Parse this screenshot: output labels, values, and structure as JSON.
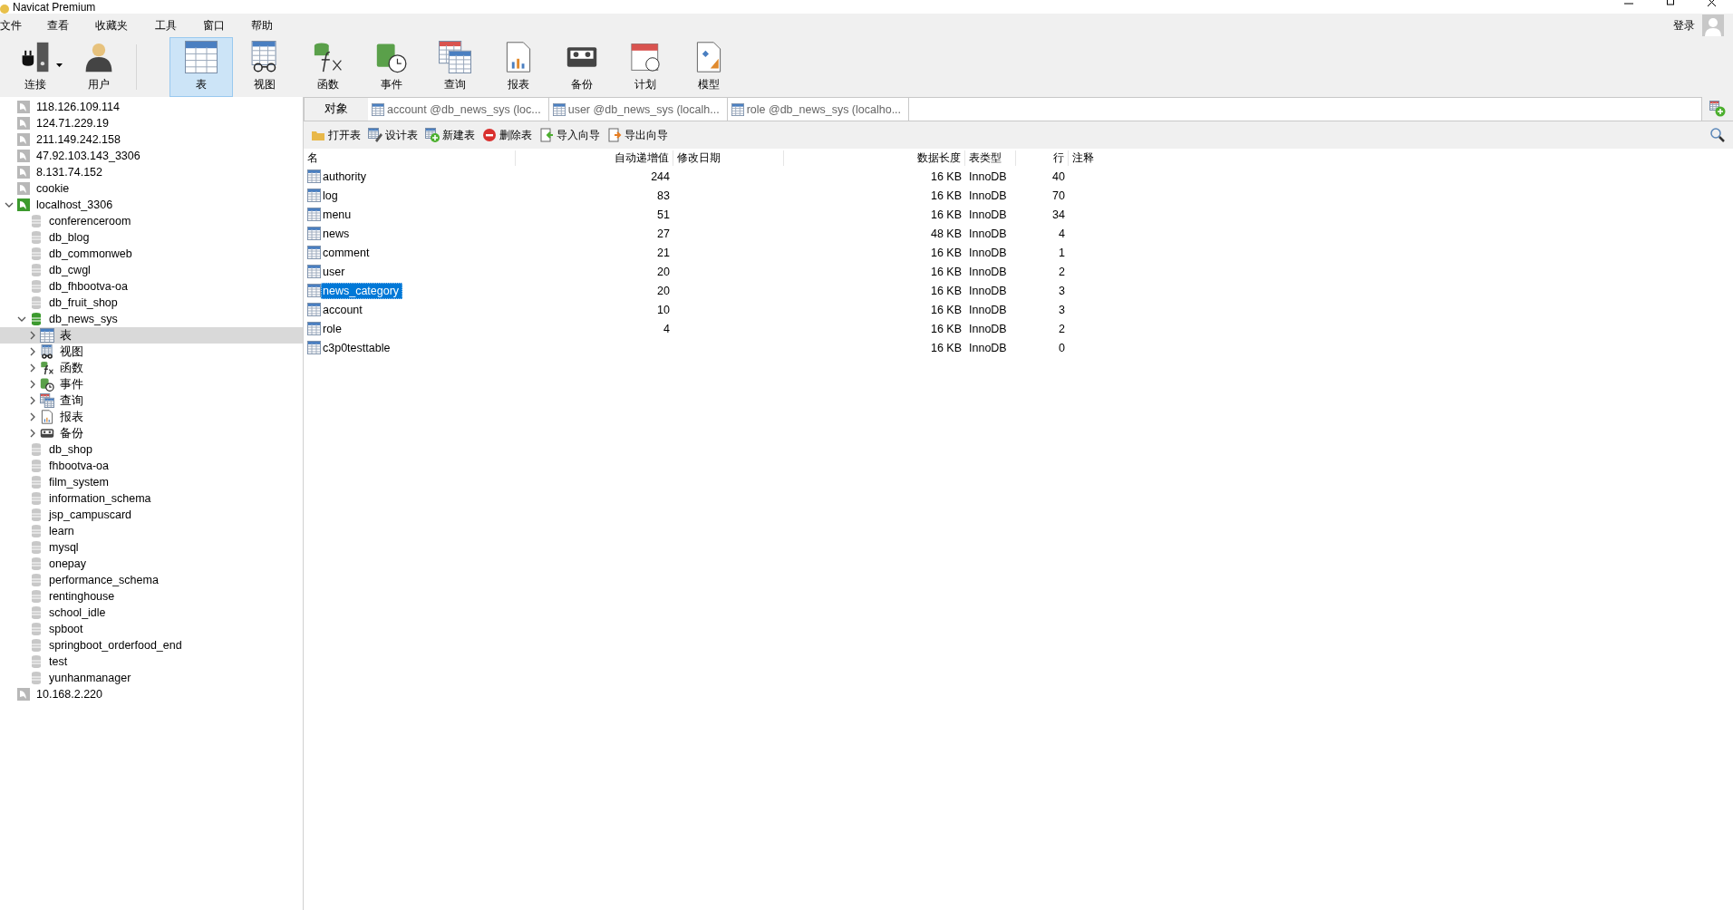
{
  "window": {
    "title": "Navicat Premium"
  },
  "menu": [
    "文件",
    "查看",
    "收藏夹",
    "工具",
    "窗口",
    "帮助"
  ],
  "account": {
    "label": "登录"
  },
  "toolbar": {
    "left": [
      {
        "kind": "connection",
        "label": "连接",
        "has_menu": true,
        "selected": false
      },
      {
        "kind": "user",
        "label": "用户",
        "has_menu": false,
        "selected": false
      }
    ],
    "objects": [
      {
        "kind": "table",
        "label": "表",
        "selected": true
      },
      {
        "kind": "view",
        "label": "视图",
        "selected": false
      },
      {
        "kind": "function",
        "label": "函数",
        "selected": false
      },
      {
        "kind": "event",
        "label": "事件",
        "selected": false
      },
      {
        "kind": "query",
        "label": "查询",
        "selected": false
      },
      {
        "kind": "report",
        "label": "报表",
        "selected": false
      },
      {
        "kind": "backup",
        "label": "备份",
        "selected": false
      },
      {
        "kind": "schedule",
        "label": "计划",
        "selected": false
      },
      {
        "kind": "model",
        "label": "模型",
        "selected": false
      }
    ]
  },
  "tree": [
    {
      "kind": "connection",
      "label": "118.126.109.114",
      "open": false,
      "selected": false
    },
    {
      "kind": "connection",
      "label": "124.71.229.19",
      "open": false,
      "selected": false
    },
    {
      "kind": "connection",
      "label": "211.149.242.158",
      "open": false,
      "selected": false
    },
    {
      "kind": "connection",
      "label": "47.92.103.143_3306",
      "open": false,
      "selected": false
    },
    {
      "kind": "connection",
      "label": "8.131.74.152",
      "open": false,
      "selected": false
    },
    {
      "kind": "connection",
      "label": "cookie",
      "open": false,
      "selected": false
    },
    {
      "kind": "connection",
      "label": "localhost_3306",
      "open": true,
      "expanded": true,
      "selected": false,
      "children": [
        {
          "kind": "database",
          "label": "conferenceroom",
          "open": false,
          "selected": false
        },
        {
          "kind": "database",
          "label": "db_blog",
          "open": false,
          "selected": false
        },
        {
          "kind": "database",
          "label": "db_commonweb",
          "open": false,
          "selected": false
        },
        {
          "kind": "database",
          "label": "db_cwgl",
          "open": false,
          "selected": false
        },
        {
          "kind": "database",
          "label": "db_fhbootva-oa",
          "open": false,
          "selected": false
        },
        {
          "kind": "database",
          "label": "db_fruit_shop",
          "open": false,
          "selected": false
        },
        {
          "kind": "database",
          "label": "db_news_sys",
          "open": true,
          "expanded": true,
          "selected": false,
          "children": [
            {
              "kind": "table",
              "label": "表",
              "expanded": false,
              "selected": true
            },
            {
              "kind": "view",
              "label": "视图",
              "expanded": false,
              "selected": false
            },
            {
              "kind": "function",
              "label": "函数",
              "expanded": false,
              "selected": false
            },
            {
              "kind": "event",
              "label": "事件",
              "expanded": false,
              "selected": false
            },
            {
              "kind": "query",
              "label": "查询",
              "expanded": false,
              "selected": false
            },
            {
              "kind": "report",
              "label": "报表",
              "expanded": false,
              "selected": false
            },
            {
              "kind": "backup",
              "label": "备份",
              "expanded": false,
              "selected": false
            }
          ]
        },
        {
          "kind": "database",
          "label": "db_shop",
          "open": false,
          "selected": false
        },
        {
          "kind": "database",
          "label": "fhbootva-oa",
          "open": false,
          "selected": false
        },
        {
          "kind": "database",
          "label": "film_system",
          "open": false,
          "selected": false
        },
        {
          "kind": "database",
          "label": "information_schema",
          "open": false,
          "selected": false
        },
        {
          "kind": "database",
          "label": "jsp_campuscard",
          "open": false,
          "selected": false
        },
        {
          "kind": "database",
          "label": "learn",
          "open": false,
          "selected": false
        },
        {
          "kind": "database",
          "label": "mysql",
          "open": false,
          "selected": false
        },
        {
          "kind": "database",
          "label": "onepay",
          "open": false,
          "selected": false
        },
        {
          "kind": "database",
          "label": "performance_schema",
          "open": false,
          "selected": false
        },
        {
          "kind": "database",
          "label": "rentinghouse",
          "open": false,
          "selected": false
        },
        {
          "kind": "database",
          "label": "school_idle",
          "open": false,
          "selected": false
        },
        {
          "kind": "database",
          "label": "spboot",
          "open": false,
          "selected": false
        },
        {
          "kind": "database",
          "label": "springboot_orderfood_end",
          "open": false,
          "selected": false
        },
        {
          "kind": "database",
          "label": "test",
          "open": false,
          "selected": false
        },
        {
          "kind": "database",
          "label": "yunhanmanager",
          "open": false,
          "selected": false
        }
      ]
    },
    {
      "kind": "connection",
      "label": "10.168.2.220",
      "open": false,
      "selected": false
    }
  ],
  "tabs": [
    {
      "kind": "objects",
      "label": "对象",
      "selected": true
    },
    {
      "kind": "table",
      "label": "account @db_news_sys (loc...",
      "selected": false
    },
    {
      "kind": "table",
      "label": "user @db_news_sys (localh...",
      "selected": false
    },
    {
      "kind": "table",
      "label": "role @db_news_sys (localho...",
      "selected": false
    }
  ],
  "actions": [
    {
      "kind": "open",
      "label": "打开表"
    },
    {
      "kind": "design",
      "label": "设计表"
    },
    {
      "kind": "new",
      "label": "新建表"
    },
    {
      "kind": "delete",
      "label": "删除表"
    },
    {
      "kind": "import",
      "label": "导入向导"
    },
    {
      "kind": "export",
      "label": "导出向导"
    }
  ],
  "table": {
    "columns": [
      "名",
      "自动递增值",
      "修改日期",
      "数据长度",
      "表类型",
      "行",
      "注释"
    ],
    "rows": [
      {
        "cells": [
          "authority",
          "244",
          "",
          "16 KB",
          "InnoDB",
          "40",
          ""
        ],
        "selected": false
      },
      {
        "cells": [
          "log",
          "83",
          "",
          "16 KB",
          "InnoDB",
          "70",
          ""
        ],
        "selected": false
      },
      {
        "cells": [
          "menu",
          "51",
          "",
          "16 KB",
          "InnoDB",
          "34",
          ""
        ],
        "selected": false
      },
      {
        "cells": [
          "news",
          "27",
          "",
          "48 KB",
          "InnoDB",
          "4",
          ""
        ],
        "selected": false
      },
      {
        "cells": [
          "comment",
          "21",
          "",
          "16 KB",
          "InnoDB",
          "1",
          ""
        ],
        "selected": false
      },
      {
        "cells": [
          "user",
          "20",
          "",
          "16 KB",
          "InnoDB",
          "2",
          ""
        ],
        "selected": false
      },
      {
        "cells": [
          "news_category",
          "20",
          "",
          "16 KB",
          "InnoDB",
          "3",
          ""
        ],
        "selected": true
      },
      {
        "cells": [
          "account",
          "10",
          "",
          "16 KB",
          "InnoDB",
          "3",
          ""
        ],
        "selected": false
      },
      {
        "cells": [
          "role",
          "4",
          "",
          "16 KB",
          "InnoDB",
          "2",
          ""
        ],
        "selected": false
      },
      {
        "cells": [
          "c3p0testtable",
          "",
          "",
          "16 KB",
          "InnoDB",
          "0",
          ""
        ],
        "selected": false
      }
    ]
  }
}
